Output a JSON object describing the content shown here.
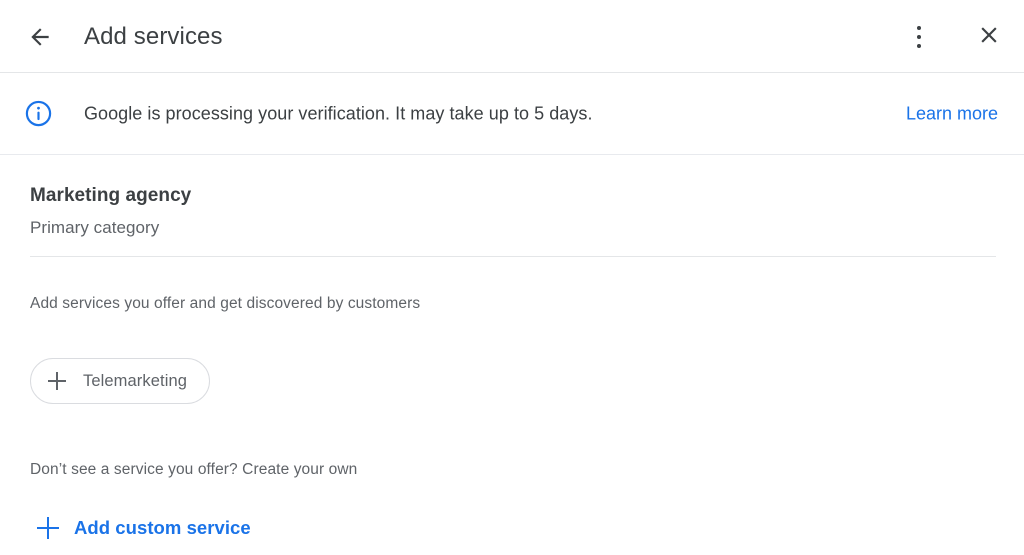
{
  "header": {
    "title": "Add services",
    "back_icon": "arrow-back-icon",
    "overflow_icon": "more-vert-icon",
    "close_icon": "close-icon"
  },
  "banner": {
    "icon": "info-circle-icon",
    "message": "Google is processing your verification. It may take up to 5 days.",
    "link_label": "Learn more",
    "link_color": "#1a73e8",
    "icon_color": "#1a73e8"
  },
  "main": {
    "category_name": "Marketing agency",
    "category_subtitle": "Primary category",
    "services_caption": "Add services you offer and get discovered by customers",
    "service_chips": [
      {
        "label": "Telemarketing",
        "icon": "plus-icon"
      }
    ],
    "custom_caption": "Don’t see a service you offer? Create your own",
    "custom_link_label": "Add custom service",
    "custom_link_icon": "plus-icon",
    "custom_link_color": "#1a73e8"
  }
}
